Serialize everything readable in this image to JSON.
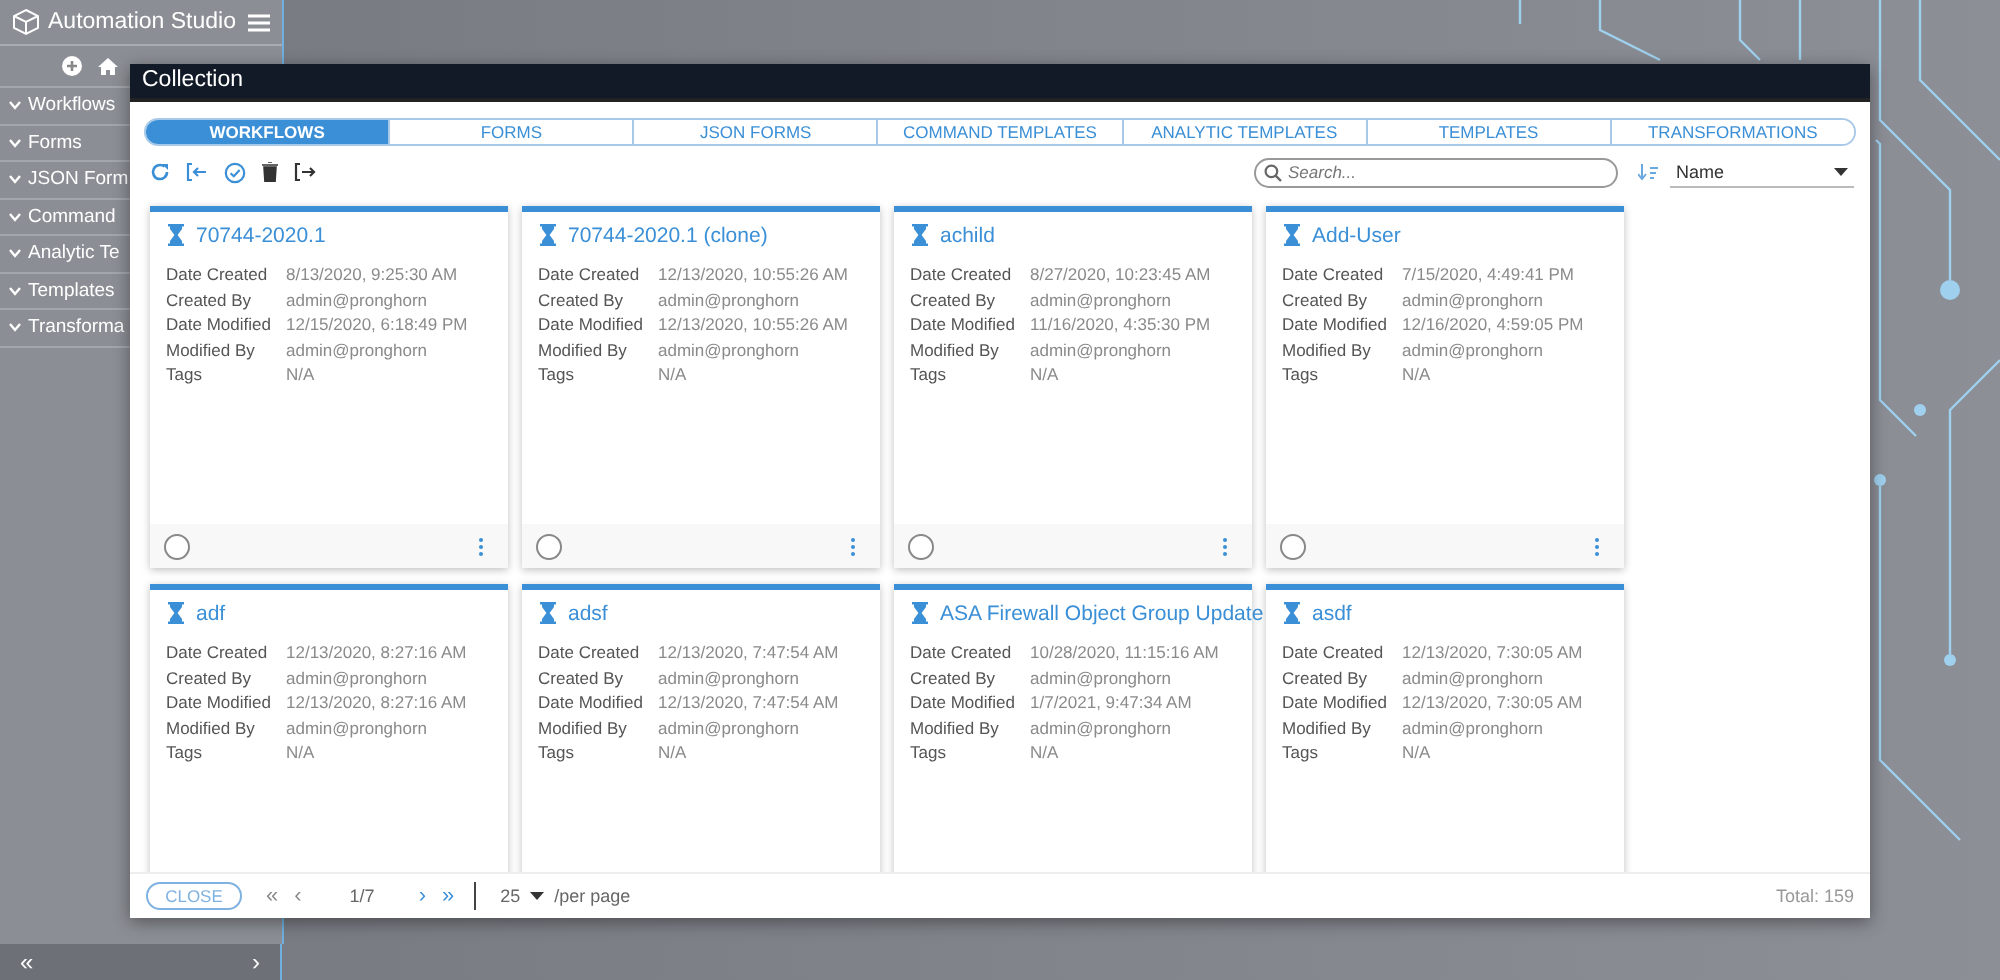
{
  "sidebar": {
    "title": "Automation Studio",
    "items": [
      {
        "label": "Workflows",
        "expanded": false
      },
      {
        "label": "Forms",
        "expanded": false
      },
      {
        "label": "JSON Form",
        "expanded": false
      },
      {
        "label": "Command",
        "expanded": false
      },
      {
        "label": "Analytic Te",
        "expanded": false
      },
      {
        "label": "Templates",
        "expanded": false
      },
      {
        "label": "Transforma",
        "expanded": false
      }
    ]
  },
  "modal": {
    "title": "Collection",
    "tabs": [
      {
        "label": "WORKFLOWS",
        "selected": true
      },
      {
        "label": "FORMS",
        "selected": false
      },
      {
        "label": "JSON FORMS",
        "selected": false
      },
      {
        "label": "COMMAND TEMPLATES",
        "selected": false
      },
      {
        "label": "ANALYTIC TEMPLATES",
        "selected": false
      },
      {
        "label": "TEMPLATES",
        "selected": false
      },
      {
        "label": "TRANSFORMATIONS",
        "selected": false
      }
    ],
    "search": {
      "placeholder": "Search..."
    },
    "sort": {
      "value": "Name"
    },
    "cards": [
      {
        "name": "70744-2020.1",
        "selected": false,
        "fields": [
          {
            "label": "Date Created",
            "value": "8/13/2020, 9:25:30 AM"
          },
          {
            "label": "Created By",
            "value": "admin@pronghorn"
          },
          {
            "label": "Date Modified",
            "value": "12/15/2020, 6:18:49 PM"
          },
          {
            "label": "Modified By",
            "value": "admin@pronghorn"
          },
          {
            "label": "Tags",
            "value": "N/A"
          }
        ]
      },
      {
        "name": "70744-2020.1 (clone)",
        "selected": false,
        "fields": [
          {
            "label": "Date Created",
            "value": "12/13/2020, 10:55:26 AM"
          },
          {
            "label": "Created By",
            "value": "admin@pronghorn"
          },
          {
            "label": "Date Modified",
            "value": "12/13/2020, 10:55:26 AM"
          },
          {
            "label": "Modified By",
            "value": "admin@pronghorn"
          },
          {
            "label": "Tags",
            "value": "N/A"
          }
        ]
      },
      {
        "name": "achild",
        "selected": false,
        "fields": [
          {
            "label": "Date Created",
            "value": "8/27/2020, 10:23:45 AM"
          },
          {
            "label": "Created By",
            "value": "admin@pronghorn"
          },
          {
            "label": "Date Modified",
            "value": "11/16/2020, 4:35:30 PM"
          },
          {
            "label": "Modified By",
            "value": "admin@pronghorn"
          },
          {
            "label": "Tags",
            "value": "N/A"
          }
        ]
      },
      {
        "name": "Add-User",
        "selected": false,
        "fields": [
          {
            "label": "Date Created",
            "value": "7/15/2020, 4:49:41 PM"
          },
          {
            "label": "Created By",
            "value": "admin@pronghorn"
          },
          {
            "label": "Date Modified",
            "value": "12/16/2020, 4:59:05 PM"
          },
          {
            "label": "Modified By",
            "value": "admin@pronghorn"
          },
          {
            "label": "Tags",
            "value": "N/A"
          }
        ]
      },
      {
        "name": "adf",
        "fields": [
          {
            "label": "Date Created",
            "value": "12/13/2020, 8:27:16 AM"
          },
          {
            "label": "Created By",
            "value": "admin@pronghorn"
          },
          {
            "label": "Date Modified",
            "value": "12/13/2020, 8:27:16 AM"
          },
          {
            "label": "Modified By",
            "value": "admin@pronghorn"
          },
          {
            "label": "Tags",
            "value": "N/A"
          }
        ]
      },
      {
        "name": "adsf",
        "fields": [
          {
            "label": "Date Created",
            "value": "12/13/2020, 7:47:54 AM"
          },
          {
            "label": "Created By",
            "value": "admin@pronghorn"
          },
          {
            "label": "Date Modified",
            "value": "12/13/2020, 7:47:54 AM"
          },
          {
            "label": "Modified By",
            "value": "admin@pronghorn"
          },
          {
            "label": "Tags",
            "value": "N/A"
          }
        ]
      },
      {
        "name": "ASA Firewall Object Group Update",
        "fields": [
          {
            "label": "Date Created",
            "value": "10/28/2020, 11:15:16 AM"
          },
          {
            "label": "Created By",
            "value": "admin@pronghorn"
          },
          {
            "label": "Date Modified",
            "value": "1/7/2021, 9:47:34 AM"
          },
          {
            "label": "Modified By",
            "value": "admin@pronghorn"
          },
          {
            "label": "Tags",
            "value": "N/A"
          }
        ]
      },
      {
        "name": "asdf",
        "fields": [
          {
            "label": "Date Created",
            "value": "12/13/2020, 7:30:05 AM"
          },
          {
            "label": "Created By",
            "value": "admin@pronghorn"
          },
          {
            "label": "Date Modified",
            "value": "12/13/2020, 7:30:05 AM"
          },
          {
            "label": "Modified By",
            "value": "admin@pronghorn"
          },
          {
            "label": "Tags",
            "value": "N/A"
          }
        ]
      }
    ],
    "footer": {
      "close": "CLOSE",
      "first": "«",
      "prev": "‹",
      "page": "1/7",
      "next": "›",
      "last": "»",
      "per_page": "25",
      "per_page_label": "/per page",
      "total": "Total: 159"
    }
  },
  "bottom_bar": {
    "collapse": "«",
    "expand": "›"
  }
}
